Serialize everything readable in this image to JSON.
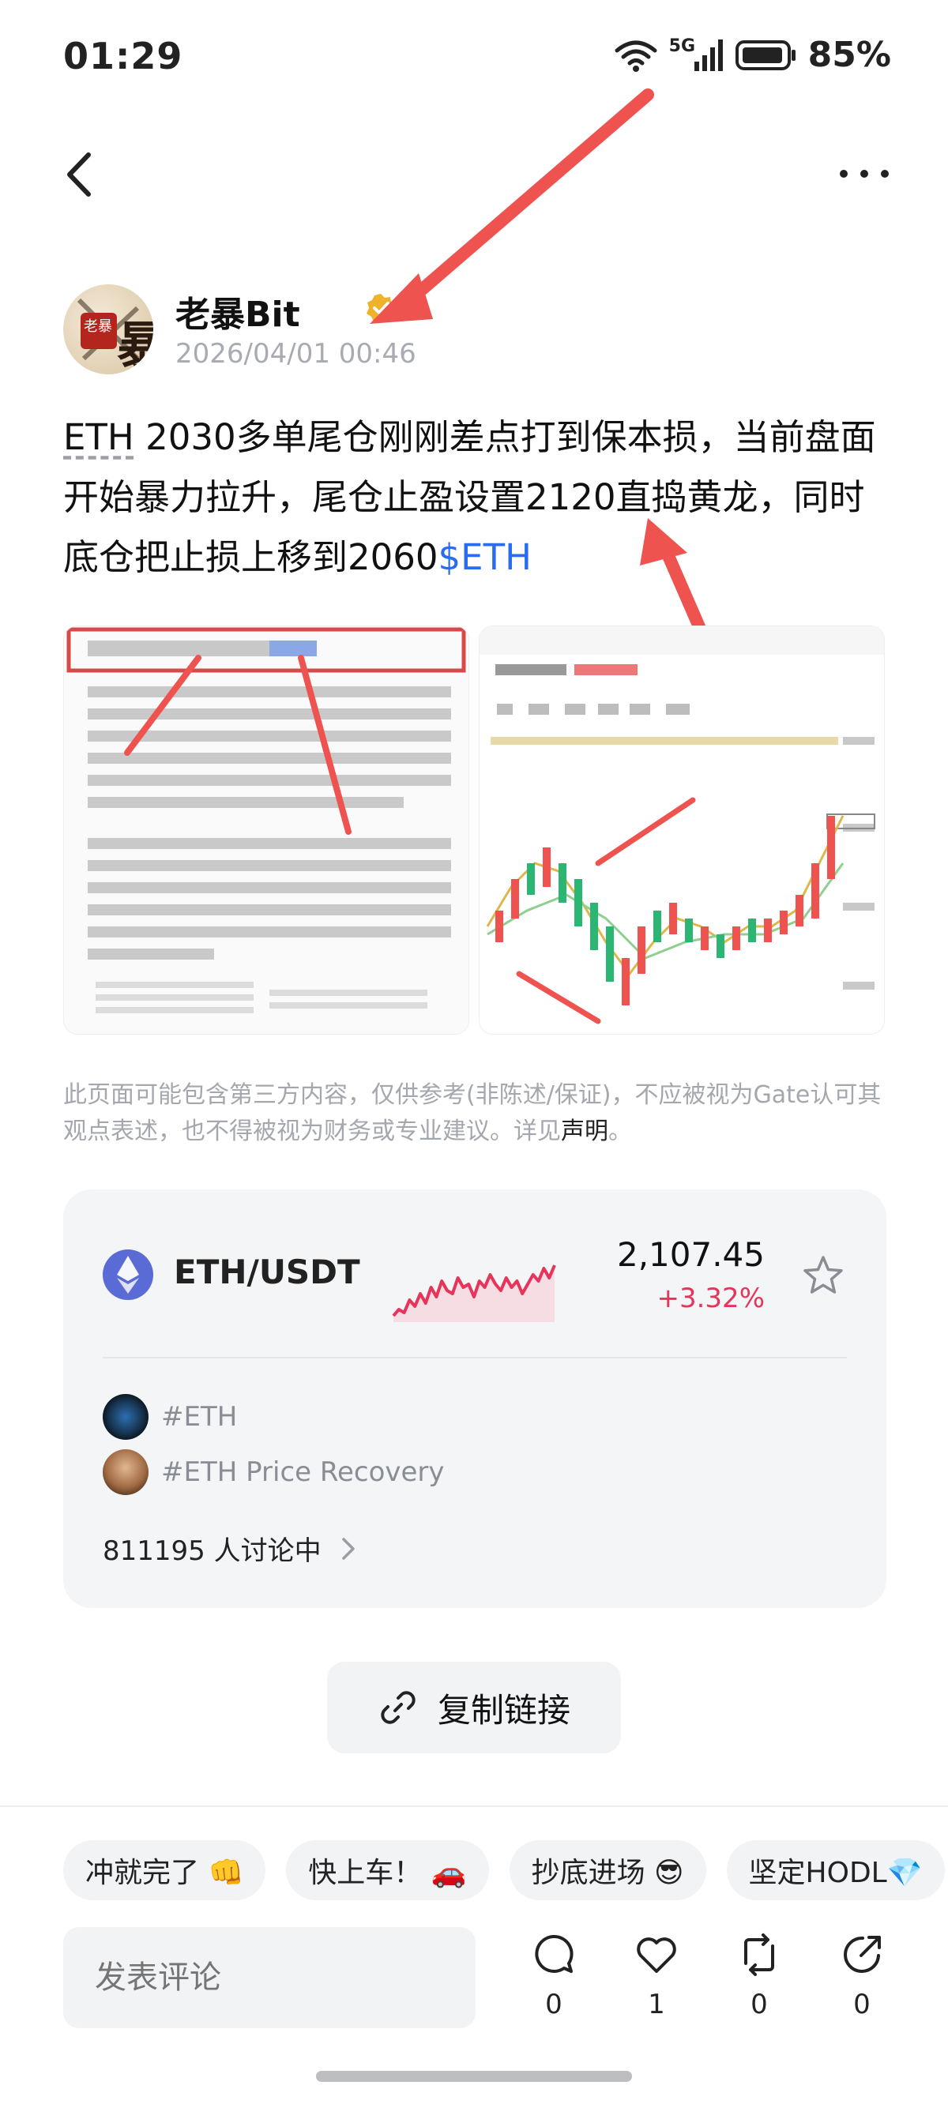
{
  "status_bar": {
    "time": "01:29",
    "network": "5G",
    "battery": "85%"
  },
  "post": {
    "author_name": "老暴Bit",
    "avatar_text": "老暴",
    "timestamp": "2026/04/01 00:46",
    "body_ticker": "ETH",
    "body_text": " 2030多单尾仓刚刚差点打到保本损，当前盘面开始暴力拉升，尾仓止盈设置2120直捣黄龙，同时底仓把止损上移到2060",
    "body_tag": "$ETH",
    "images": {
      "left_alt": "article screenshot",
      "right_alt": "ETH/USDT candlestick chart"
    }
  },
  "disclaimer": {
    "text": "此页面可能包含第三方内容，仅供参考(非陈述/保证)，不应被视为Gate认可其观点表述，也不得被视为财务或专业建议。详见",
    "link": "声明",
    "end": "。"
  },
  "market": {
    "pair": "ETH/USDT",
    "price": "2,107.45",
    "change": "+3.32%",
    "change_color": "#e7345b",
    "sparkline": [
      3,
      5,
      4,
      8,
      6,
      10,
      7,
      12,
      9,
      14,
      11,
      10,
      15,
      12,
      13,
      9,
      14,
      12,
      16,
      13,
      11,
      15,
      12,
      14,
      10,
      13,
      16,
      14,
      18,
      15,
      19
    ]
  },
  "topics": [
    {
      "label": "#ETH",
      "icon": "eth-topic-icon"
    },
    {
      "label": "#ETH Price Recovery",
      "icon": "person-avatar-icon"
    }
  ],
  "discussion": {
    "text": "811195 人讨论中"
  },
  "copy_link": {
    "label": "复制链接"
  },
  "quick_replies": [
    "冲就完了 👊",
    "快上车！ 🚗",
    "抄底进场 😎",
    "坚定HODL💎"
  ],
  "comment": {
    "placeholder": "发表评论"
  },
  "actions": {
    "comments": "0",
    "likes": "1",
    "reposts": "0",
    "shares": "0"
  },
  "colors": {
    "accent_blue": "#2a6cf0",
    "up_red": "#e7345b",
    "card_bg": "#f4f5f7"
  }
}
